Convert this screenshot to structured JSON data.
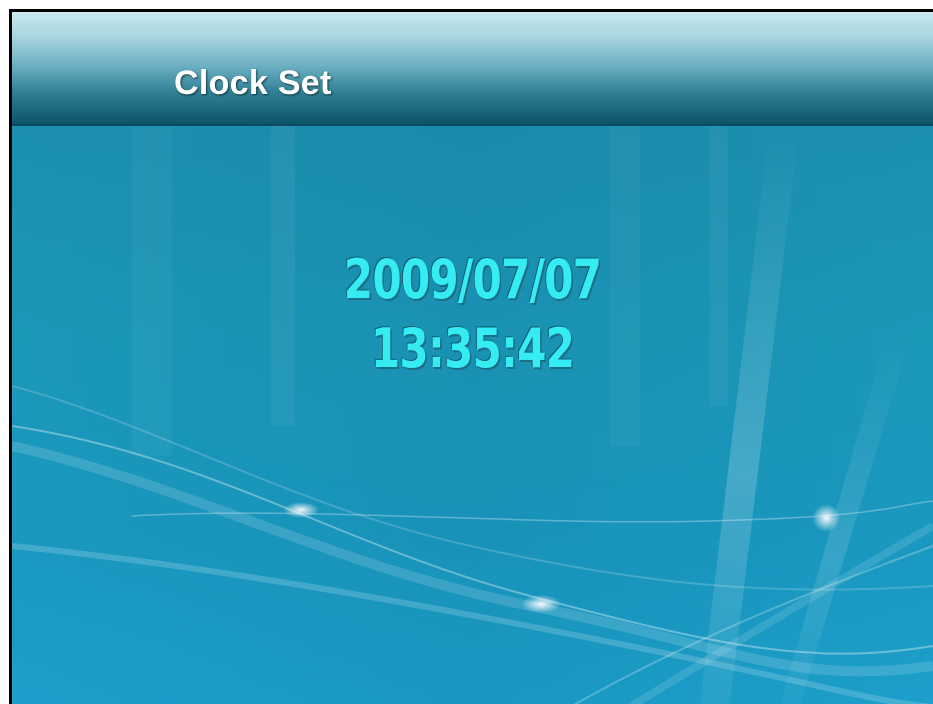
{
  "header": {
    "title": "Clock Set"
  },
  "clock": {
    "date": "2009/07/07",
    "time": "13:35:42"
  },
  "colors": {
    "clock_text": "#35ecf2",
    "background": "#1e97b3",
    "header_top": "#c9e7ee",
    "header_bottom": "#0c5468"
  }
}
